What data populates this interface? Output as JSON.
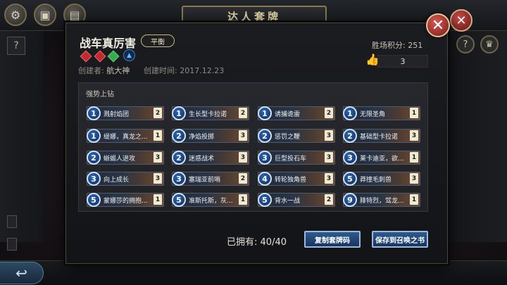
{
  "header": {
    "title": "达人套牌"
  },
  "nav": {
    "back_icon": "↩"
  },
  "deck": {
    "name": "战车真厉害",
    "tag": "平衡",
    "creator_label": "创建者:",
    "creator": "航大神",
    "created_label": "创建时间:",
    "created_at": "2017.12.23",
    "score_label": "胜场积分:",
    "score": "251",
    "likes": "3",
    "gem_colors": [
      "#c8272d",
      "#c8272d",
      "#2fae4a"
    ]
  },
  "panel": {
    "title": "强势上钻",
    "cards": [
      {
        "cost": "1",
        "name": "溅射焰团",
        "count": "2"
      },
      {
        "cost": "1",
        "name": "生长型卡拉诺",
        "count": "2"
      },
      {
        "cost": "1",
        "name": "诱捕诡雷",
        "count": "2"
      },
      {
        "cost": "1",
        "name": "无限圣角",
        "count": "1"
      },
      {
        "cost": "1",
        "name": "缇娜，真龙之...",
        "count": "1"
      },
      {
        "cost": "2",
        "name": "净焰投掷",
        "count": "3"
      },
      {
        "cost": "2",
        "name": "惩罚之鞭",
        "count": "3"
      },
      {
        "cost": "2",
        "name": "基础型卡拉诺",
        "count": "3"
      },
      {
        "cost": "2",
        "name": "蜥蜴人进攻",
        "count": "3"
      },
      {
        "cost": "2",
        "name": "迷惑战术",
        "count": "3"
      },
      {
        "cost": "3",
        "name": "巨型投石车",
        "count": "3"
      },
      {
        "cost": "3",
        "name": "莱卡迪亚，欲...",
        "count": "1"
      },
      {
        "cost": "3",
        "name": "向上成长",
        "count": "3"
      },
      {
        "cost": "3",
        "name": "塞瑞亚前哨",
        "count": "2"
      },
      {
        "cost": "4",
        "name": "转轮独角兽",
        "count": "3"
      },
      {
        "cost": "5",
        "name": "莽撞毛刺兽",
        "count": "3"
      },
      {
        "cost": "5",
        "name": "蒙娜莎的拥抱...",
        "count": "1"
      },
      {
        "cost": "5",
        "name": "准斯托斯，灰...",
        "count": "1"
      },
      {
        "cost": "5",
        "name": "背水一战",
        "count": "2"
      },
      {
        "cost": "9",
        "name": "腓特烈，驾龙...",
        "count": "1"
      }
    ]
  },
  "footer": {
    "owned_label": "已拥有:",
    "owned_value": "40/40",
    "copy_button": "复制套牌码",
    "save_button": "保存到召唤之书"
  }
}
